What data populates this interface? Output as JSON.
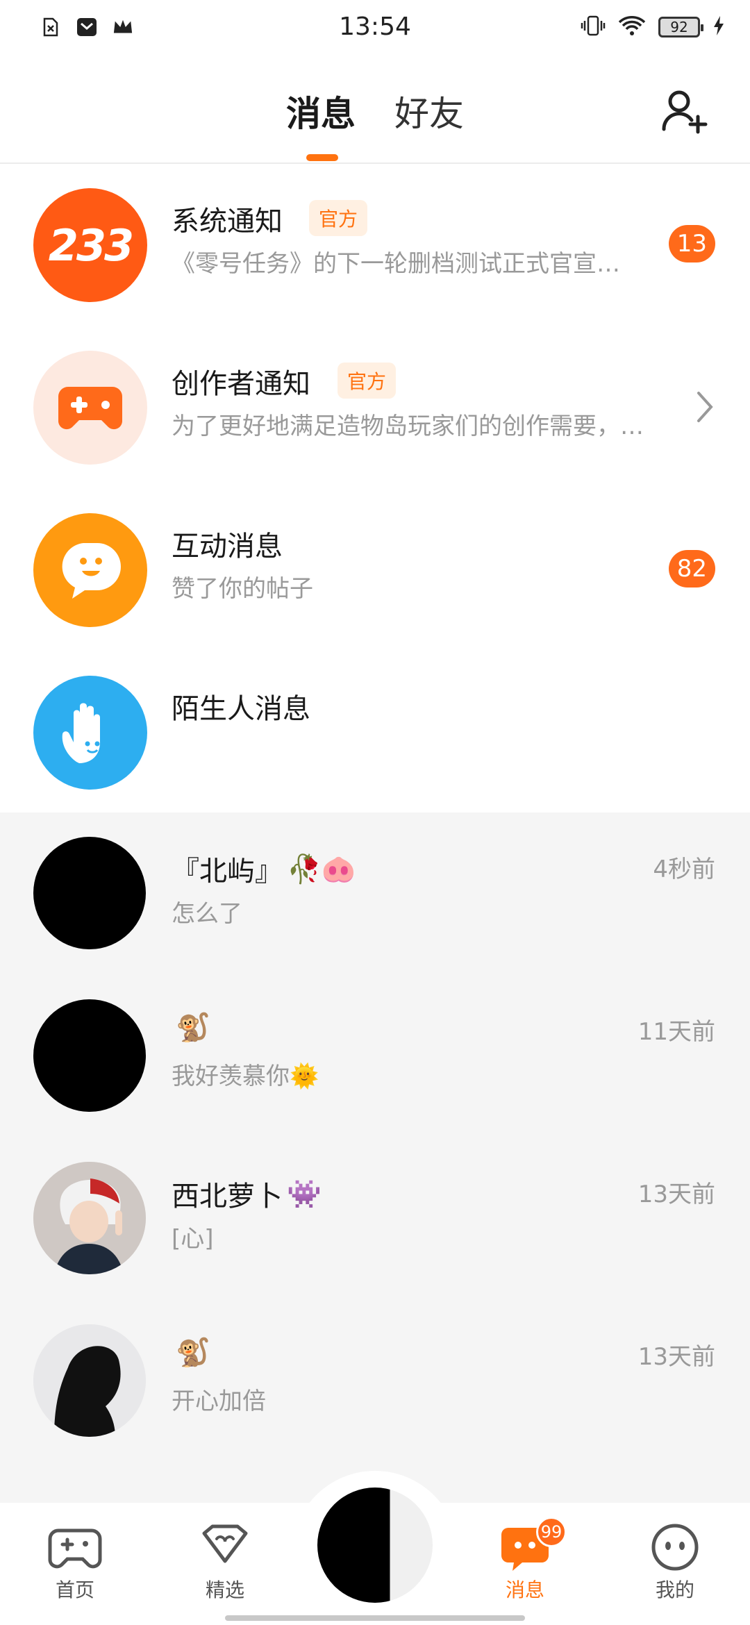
{
  "status_bar": {
    "time": "13:54",
    "battery": "92",
    "left_icons": [
      "sim-off-icon",
      "mail-icon",
      "crown-icon"
    ],
    "right_icons": [
      "vibrate-icon",
      "wifi-icon",
      "battery-icon",
      "charging-icon"
    ]
  },
  "header": {
    "tabs": [
      {
        "label": "消息",
        "active": true
      },
      {
        "label": "好友",
        "active": false
      }
    ],
    "add_friend_icon": "add-user-icon"
  },
  "official": [
    {
      "title": "系统通知",
      "tag": "官方",
      "preview": "《零号任务》的下一轮删档测试正式官宣…",
      "badge": "13",
      "avatar_text": "233",
      "avatar_color": "#ff5a14"
    },
    {
      "title": "创作者通知",
      "tag": "官方",
      "preview": "为了更好地满足造物岛玩家们的创作需要，…",
      "avatar_color": "#fde9e0"
    },
    {
      "title": "互动消息",
      "preview": "赞了你的帖子",
      "badge": "82",
      "avatar_color": "#ff9a10"
    },
    {
      "title": "陌生人消息",
      "avatar_color": "#2daef0"
    }
  ],
  "chats": [
    {
      "name": "『北屿』",
      "emoji": "🥀🐽",
      "preview": "怎么了",
      "time": "4秒前"
    },
    {
      "name": "",
      "emoji": "🐒",
      "preview": "我好羡慕你🌞",
      "time": "11天前"
    },
    {
      "name": "西北萝卜",
      "emoji": "👾",
      "preview": "[心]",
      "time": "13天前"
    },
    {
      "name": "",
      "emoji": "🐒",
      "preview": "开心加倍",
      "time": "13天前"
    }
  ],
  "nav": {
    "items": [
      {
        "label": "首页",
        "icon": "gamepad-icon"
      },
      {
        "label": "精选",
        "icon": "heart-badge-icon"
      },
      {
        "label": "消息",
        "icon": "message-icon",
        "badge": "99",
        "active": true
      },
      {
        "label": "我的",
        "icon": "profile-face-icon"
      }
    ]
  },
  "colors": {
    "accent": "#ff7210",
    "badge": "#ff6a1a"
  }
}
